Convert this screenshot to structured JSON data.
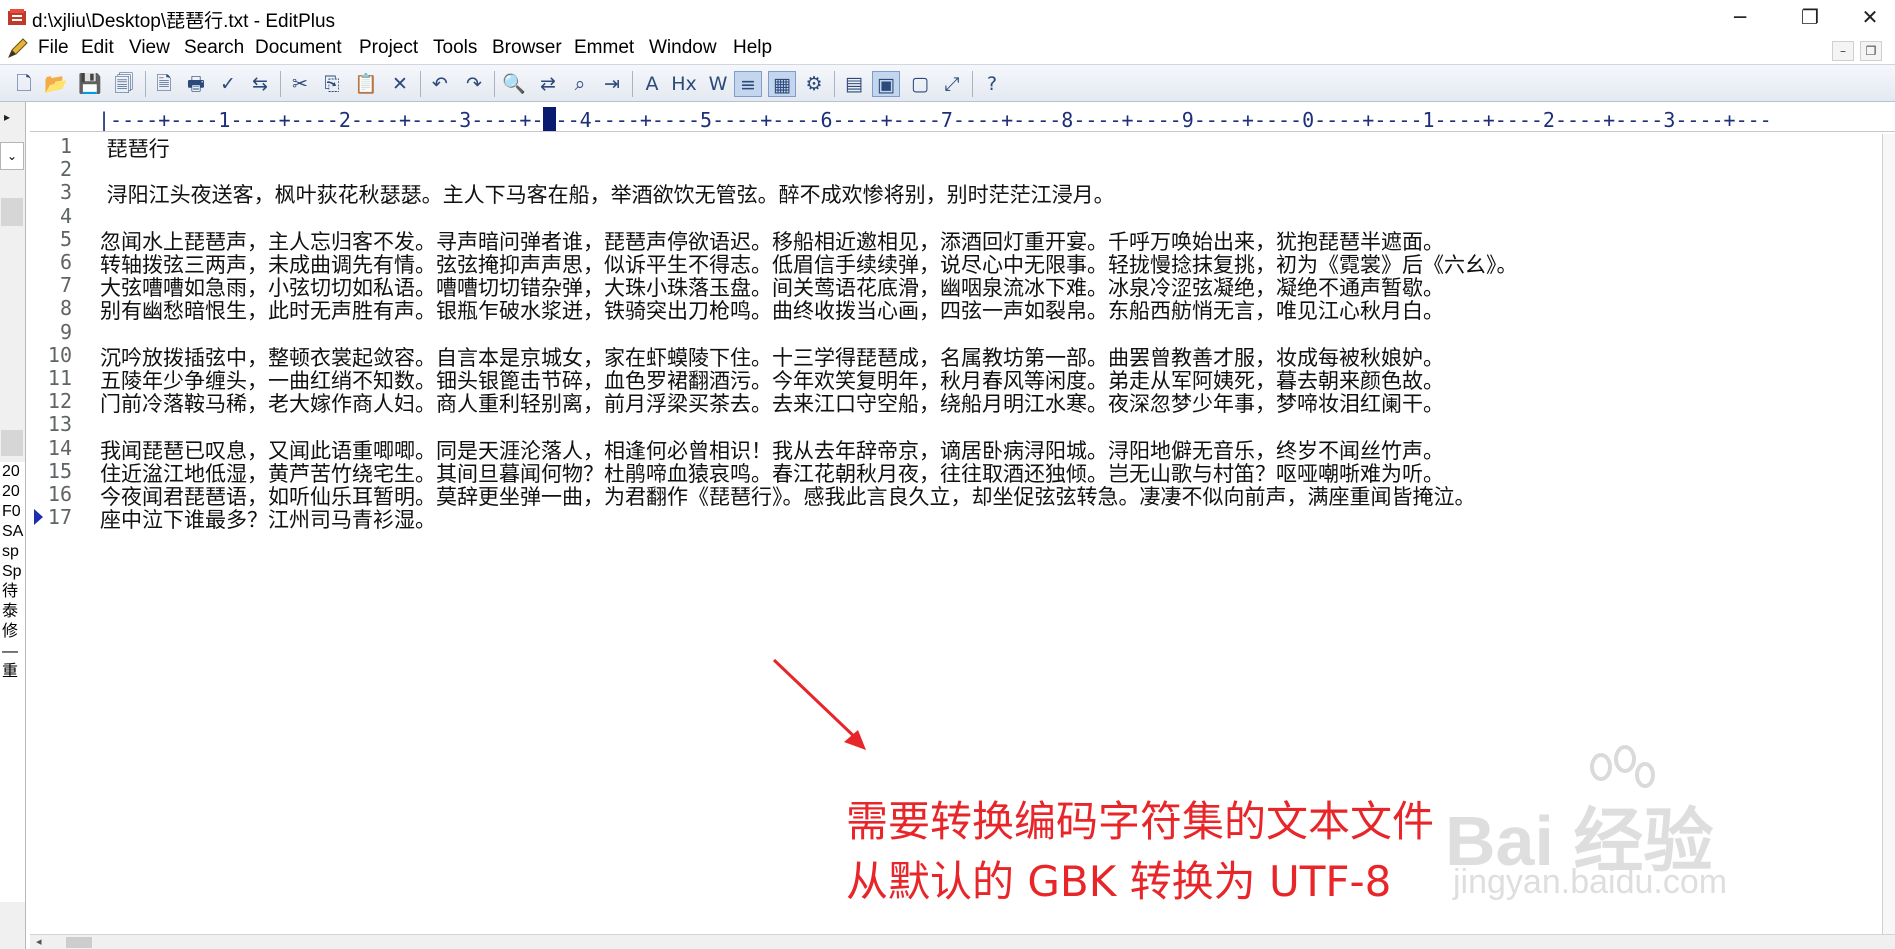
{
  "window": {
    "title": "d:\\xjliu\\Desktop\\琵琶行.txt - EditPlus",
    "controls": {
      "minimize": "─",
      "maximize": "❐",
      "close": "✕"
    }
  },
  "menu": [
    "File",
    "Edit",
    "View",
    "Search",
    "Document",
    "Project",
    "Tools",
    "Browser",
    "Emmet",
    "Window",
    "Help"
  ],
  "mdi": {
    "minimize": "–",
    "restore": "❐"
  },
  "toolbar": {
    "icons": [
      {
        "name": "new-file-icon",
        "glyph": "🗋"
      },
      {
        "name": "open-file-icon",
        "glyph": "📂"
      },
      {
        "name": "save-icon",
        "glyph": "💾"
      },
      {
        "name": "save-all-icon",
        "glyph": "🗐"
      },
      {
        "name": "print-preview-icon",
        "glyph": "🗎"
      },
      {
        "name": "print-icon",
        "glyph": "🖶"
      },
      {
        "name": "spell-check-icon",
        "glyph": "✓"
      },
      {
        "name": "browser-view-icon",
        "glyph": "⇆"
      },
      {
        "name": "cut-icon",
        "glyph": "✂"
      },
      {
        "name": "copy-icon",
        "glyph": "⎘"
      },
      {
        "name": "paste-icon",
        "glyph": "📋"
      },
      {
        "name": "delete-icon",
        "glyph": "✕"
      },
      {
        "name": "undo-icon",
        "glyph": "↶"
      },
      {
        "name": "redo-icon",
        "glyph": "↷"
      },
      {
        "name": "find-icon",
        "glyph": "🔍"
      },
      {
        "name": "replace-icon",
        "glyph": "⇄"
      },
      {
        "name": "find-in-files-icon",
        "glyph": "⌕"
      },
      {
        "name": "goto-line-icon",
        "glyph": "⇥"
      },
      {
        "name": "font-icon",
        "glyph": "A"
      },
      {
        "name": "hex-view-icon",
        "glyph": "Hx"
      },
      {
        "name": "word-wrap-icon",
        "glyph": "W"
      },
      {
        "name": "line-number-icon",
        "glyph": "≡"
      },
      {
        "name": "ruler-icon",
        "glyph": "▦"
      },
      {
        "name": "preferences-icon",
        "glyph": "⚙"
      },
      {
        "name": "directory-window-icon",
        "glyph": "▤"
      },
      {
        "name": "cliptext-window-icon",
        "glyph": "▣"
      },
      {
        "name": "output-window-icon",
        "glyph": "▢"
      },
      {
        "name": "fullscreen-icon",
        "glyph": "⤢"
      },
      {
        "name": "help-icon",
        "glyph": "?"
      }
    ]
  },
  "left_panel": {
    "expand_arrow": "▸",
    "dropdown_arrow": "⌄",
    "files": [
      "20",
      "20",
      "F0",
      "SA",
      "sp",
      "Sp",
      "待",
      "泰",
      "修",
      "—",
      "重"
    ]
  },
  "ruler": {
    "text": "|----+----1----+----2----+----3----+----4----+----5----+----6----+----7----+----8----+----9----+----0----+----1----+----2----+----3----+---"
  },
  "editor": {
    "lines": [
      {
        "num": "1",
        "text": " 琵琶行"
      },
      {
        "num": "2",
        "text": ""
      },
      {
        "num": "3",
        "text": " 浔阳江头夜送客，枫叶荻花秋瑟瑟。主人下马客在船，举酒欲饮无管弦。醉不成欢惨将别，别时茫茫江浸月。"
      },
      {
        "num": "4",
        "text": ""
      },
      {
        "num": "5",
        "text": "忽闻水上琵琶声，主人忘归客不发。寻声暗问弹者谁，琵琶声停欲语迟。移船相近邀相见，添酒回灯重开宴。千呼万唤始出来，犹抱琵琶半遮面。"
      },
      {
        "num": "6",
        "text": "转轴拨弦三两声，未成曲调先有情。弦弦掩抑声声思，似诉平生不得志。低眉信手续续弹，说尽心中无限事。轻拢慢捻抹复挑，初为《霓裳》后《六幺》。"
      },
      {
        "num": "7",
        "text": "大弦嘈嘈如急雨，小弦切切如私语。嘈嘈切切错杂弹，大珠小珠落玉盘。间关莺语花底滑，幽咽泉流冰下难。冰泉冷涩弦凝绝，凝绝不通声暂歇。"
      },
      {
        "num": "8",
        "text": "别有幽愁暗恨生，此时无声胜有声。银瓶乍破水浆迸，铁骑突出刀枪鸣。曲终收拨当心画，四弦一声如裂帛。东船西舫悄无言，唯见江心秋月白。"
      },
      {
        "num": "9",
        "text": ""
      },
      {
        "num": "10",
        "text": "沉吟放拨插弦中，整顿衣裳起敛容。自言本是京城女，家在虾蟆陵下住。十三学得琵琶成，名属教坊第一部。曲罢曾教善才服，妆成每被秋娘妒。"
      },
      {
        "num": "11",
        "text": "五陵年少争缠头，一曲红绡不知数。钿头银篦击节碎，血色罗裙翻酒污。今年欢笑复明年，秋月春风等闲度。弟走从军阿姨死，暮去朝来颜色故。"
      },
      {
        "num": "12",
        "text": "门前冷落鞍马稀，老大嫁作商人妇。商人重利轻别离，前月浮梁买茶去。去来江口守空船，绕船月明江水寒。夜深忽梦少年事，梦啼妆泪红阑干。"
      },
      {
        "num": "13",
        "text": ""
      },
      {
        "num": "14",
        "text": "我闻琵琶已叹息，又闻此语重唧唧。同是天涯沦落人，相逢何必曾相识！我从去年辞帝京，谪居卧病浔阳城。浔阳地僻无音乐，终岁不闻丝竹声。"
      },
      {
        "num": "15",
        "text": "住近湓江地低湿，黄芦苦竹绕宅生。其间旦暮闻何物？杜鹃啼血猿哀鸣。春江花朝秋月夜，往往取酒还独倾。岂无山歌与村笛？呕哑嘲哳难为听。"
      },
      {
        "num": "16",
        "text": "今夜闻君琵琶语，如听仙乐耳暂明。莫辞更坐弹一曲，为君翻作《琵琶行》。感我此言良久立，却坐促弦弦转急。凄凄不似向前声，满座重闻皆掩泣。"
      },
      {
        "num": "17",
        "text": "座中泣下谁最多？江州司马青衫湿。"
      }
    ]
  },
  "scrollbar": {
    "left_arrow": "◂"
  },
  "annotation": {
    "line1": "需要转换编码字符集的文本文件",
    "line2": "从默认的 GBK 转换为 UTF-8",
    "color": "#e8262a"
  },
  "watermark": {
    "brand": "Bai 经验",
    "url": "jingyan.baidu.com"
  }
}
